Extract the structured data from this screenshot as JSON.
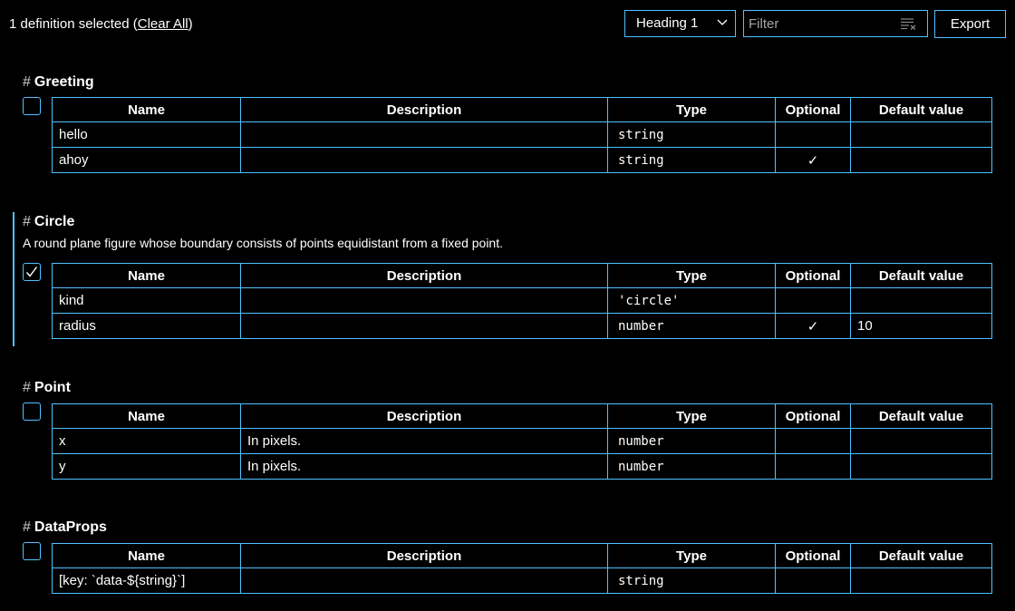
{
  "toolbar": {
    "selection_text": "1 definition selected (",
    "clear_all_label": "Clear All",
    "selection_suffix": ")",
    "heading_select_value": "Heading 1",
    "filter_placeholder": "Filter",
    "filter_value": "",
    "export_label": "Export"
  },
  "columns": [
    "Name",
    "Description",
    "Type",
    "Optional",
    "Default value"
  ],
  "sections": [
    {
      "hash": "#",
      "title": "Greeting",
      "description": "",
      "checked": false,
      "rows": [
        {
          "name": "hello",
          "description": "",
          "type": "string",
          "optional": "",
          "default": ""
        },
        {
          "name": "ahoy",
          "description": "",
          "type": "string",
          "optional": "✓",
          "default": ""
        }
      ]
    },
    {
      "hash": "#",
      "title": "Circle",
      "description": "A round plane figure whose boundary consists of points equidistant from a fixed point.",
      "checked": true,
      "rows": [
        {
          "name": "kind",
          "description": "",
          "type": "'circle'",
          "optional": "",
          "default": ""
        },
        {
          "name": "radius",
          "description": "",
          "type": "number",
          "optional": "✓",
          "default": "10"
        }
      ]
    },
    {
      "hash": "#",
      "title": "Point",
      "description": "",
      "checked": false,
      "rows": [
        {
          "name": "x",
          "description": "In pixels.",
          "type": "number",
          "optional": "",
          "default": ""
        },
        {
          "name": "y",
          "description": "In pixels.",
          "type": "number",
          "optional": "",
          "default": ""
        }
      ]
    },
    {
      "hash": "#",
      "title": "DataProps",
      "description": "",
      "checked": false,
      "rows": [
        {
          "name": "[key: `data-${string}`]",
          "description": "",
          "type": "string",
          "optional": "",
          "default": ""
        }
      ]
    }
  ],
  "colors": {
    "accent": "#4fc1ff",
    "background": "#000000",
    "text": "#ffffff"
  }
}
